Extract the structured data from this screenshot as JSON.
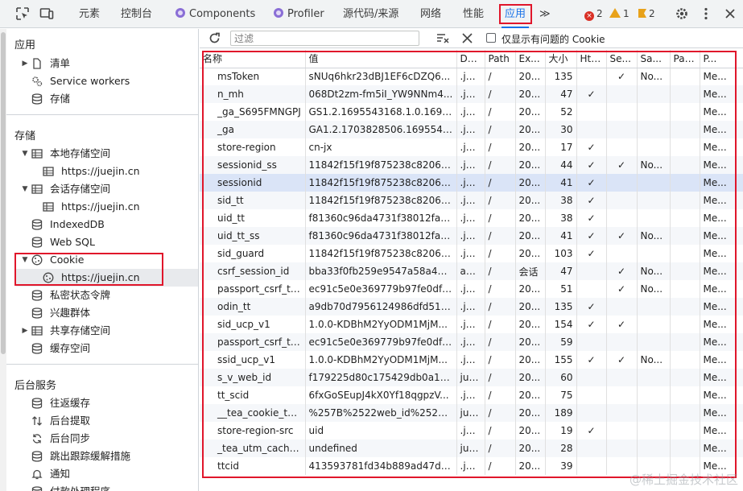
{
  "topbar": {
    "tabs": [
      {
        "label": "元素",
        "icon": ""
      },
      {
        "label": "控制台",
        "icon": ""
      },
      {
        "label": "Components",
        "icon": "react-icon"
      },
      {
        "label": "Profiler",
        "icon": "react-icon"
      },
      {
        "label": "源代码/来源",
        "icon": ""
      },
      {
        "label": "网络",
        "icon": ""
      },
      {
        "label": "性能",
        "icon": ""
      },
      {
        "label": "应用",
        "icon": ""
      }
    ],
    "more_label": "≫",
    "errors": "2",
    "warnings": "1",
    "issues": "2"
  },
  "sidebar": {
    "section_app": "应用",
    "app_items": [
      "清单",
      "Service workers",
      "存储"
    ],
    "section_storage": "存储",
    "storage_items": [
      "本地存储空间",
      "https://juejin.cn",
      "会话存储空间",
      "https://juejin.cn",
      "IndexedDB",
      "Web SQL",
      "Cookie",
      "https://juejin.cn",
      "私密状态令牌",
      "兴趣群体",
      "共享存储空间",
      "缓存空间"
    ],
    "section_bg": "后台服务",
    "bg_items": [
      "往返缓存",
      "后台提取",
      "后台同步",
      "跳出跟踪缓解措施",
      "通知",
      "付款处理程序"
    ]
  },
  "toolbar": {
    "filter_placeholder": "过滤",
    "only_issues_label": "仅显示有问题的 Cookie"
  },
  "table": {
    "columns": [
      "名称",
      "值",
      "Do...",
      "Path",
      "Ex...",
      "大小",
      "Htt...",
      "Se...",
      "Sa...",
      "Par...",
      "P..."
    ],
    "rows": [
      [
        "msToken",
        "sNUq6hkr23dBJ1EF6cDZQ6...",
        ".ju...",
        "/",
        "20...",
        "135",
        "",
        "✓",
        "No...",
        "",
        "Me..."
      ],
      [
        "n_mh",
        "068Dt2zm-fm5iI_YW9NNm4...",
        ".ju...",
        "/",
        "20...",
        "47",
        "✓",
        "",
        "",
        "",
        "Me..."
      ],
      [
        "_ga_S695FMNGPJ",
        "GS1.2.1695543168.1.0.16955...",
        ".ju...",
        "/",
        "20...",
        "52",
        "",
        "",
        "",
        "",
        "Me..."
      ],
      [
        "_ga",
        "GA1.2.1703828506.1695543...",
        ".ju...",
        "/",
        "20...",
        "30",
        "",
        "",
        "",
        "",
        "Me..."
      ],
      [
        "store-region",
        "cn-jx",
        ".ju...",
        "/",
        "20...",
        "17",
        "✓",
        "",
        "",
        "",
        "Me..."
      ],
      [
        "sessionid_ss",
        "11842f15f19f875238c82063...",
        ".ju...",
        "/",
        "20...",
        "44",
        "✓",
        "✓",
        "No...",
        "",
        "Me..."
      ],
      [
        "sessionid",
        "11842f15f19f875238c82063...",
        ".ju...",
        "/",
        "20...",
        "41",
        "✓",
        "",
        "",
        "",
        "Me..."
      ],
      [
        "sid_tt",
        "11842f15f19f875238c82063...",
        ".ju...",
        "/",
        "20...",
        "38",
        "✓",
        "",
        "",
        "",
        "Me..."
      ],
      [
        "uid_tt",
        "f81360c96da4731f38012fa7c...",
        ".ju...",
        "/",
        "20...",
        "38",
        "✓",
        "",
        "",
        "",
        "Me..."
      ],
      [
        "uid_tt_ss",
        "f81360c96da4731f38012fa7c...",
        ".ju...",
        "/",
        "20...",
        "41",
        "✓",
        "✓",
        "No...",
        "",
        "Me..."
      ],
      [
        "sid_guard",
        "11842f15f19f875238c82063...",
        ".ju...",
        "/",
        "20...",
        "103",
        "✓",
        "",
        "",
        "",
        "Me..."
      ],
      [
        "csrf_session_id",
        "bba33f0fb259e9547a58a47f...",
        "api...",
        "/",
        "会话",
        "47",
        "",
        "✓",
        "No...",
        "",
        "Me..."
      ],
      [
        "passport_csrf_to...",
        "ec91c5e0e369779b97fe0df5...",
        ".ju...",
        "/",
        "20...",
        "51",
        "",
        "✓",
        "No...",
        "",
        "Me..."
      ],
      [
        "odin_tt",
        "a9db70d7956124986dfd519...",
        ".ju...",
        "/",
        "20...",
        "135",
        "✓",
        "",
        "",
        "",
        "Me..."
      ],
      [
        "sid_ucp_v1",
        "1.0.0-KDBhM2YyODM1MjM...",
        ".ju...",
        "/",
        "20...",
        "154",
        "✓",
        "✓",
        "",
        "",
        "Me..."
      ],
      [
        "passport_csrf_to...",
        "ec91c5e0e369779b97fe0df5...",
        ".ju...",
        "/",
        "20...",
        "59",
        "",
        "",
        "",
        "",
        "Me..."
      ],
      [
        "ssid_ucp_v1",
        "1.0.0-KDBhM2YyODM1MjM...",
        ".ju...",
        "/",
        "20...",
        "155",
        "✓",
        "✓",
        "No...",
        "",
        "Me..."
      ],
      [
        "s_v_web_id",
        "f179225d80c175429db0a1a...",
        "jue...",
        "/",
        "20...",
        "60",
        "",
        "",
        "",
        "",
        "Me..."
      ],
      [
        "tt_scid",
        "6fxGoSEupJ4kX0Yf18qgpzV...",
        ".ju...",
        "/",
        "20...",
        "75",
        "",
        "",
        "",
        "",
        "Me..."
      ],
      [
        "__tea_cookie_to...",
        "%257B%2522web_id%2522...",
        "jue...",
        "/",
        "20...",
        "189",
        "",
        "",
        "",
        "",
        "Me..."
      ],
      [
        "store-region-src",
        "uid",
        ".ju...",
        "/",
        "20...",
        "19",
        "✓",
        "",
        "",
        "",
        "Me..."
      ],
      [
        "_tea_utm_cache...",
        "undefined",
        "jue...",
        "/",
        "20...",
        "28",
        "",
        "",
        "",
        "",
        "Me..."
      ],
      [
        "ttcid",
        "413593781fd34b889ad47df3...",
        ".ju...",
        "/",
        "20...",
        "39",
        "",
        "",
        "",
        "",
        "Me..."
      ]
    ]
  },
  "watermark": "@稀土掘金技术社区",
  "colors": {
    "accent": "#1a73e8",
    "highlight_box": "#e0162b",
    "selected_row": "#dae4f7"
  }
}
